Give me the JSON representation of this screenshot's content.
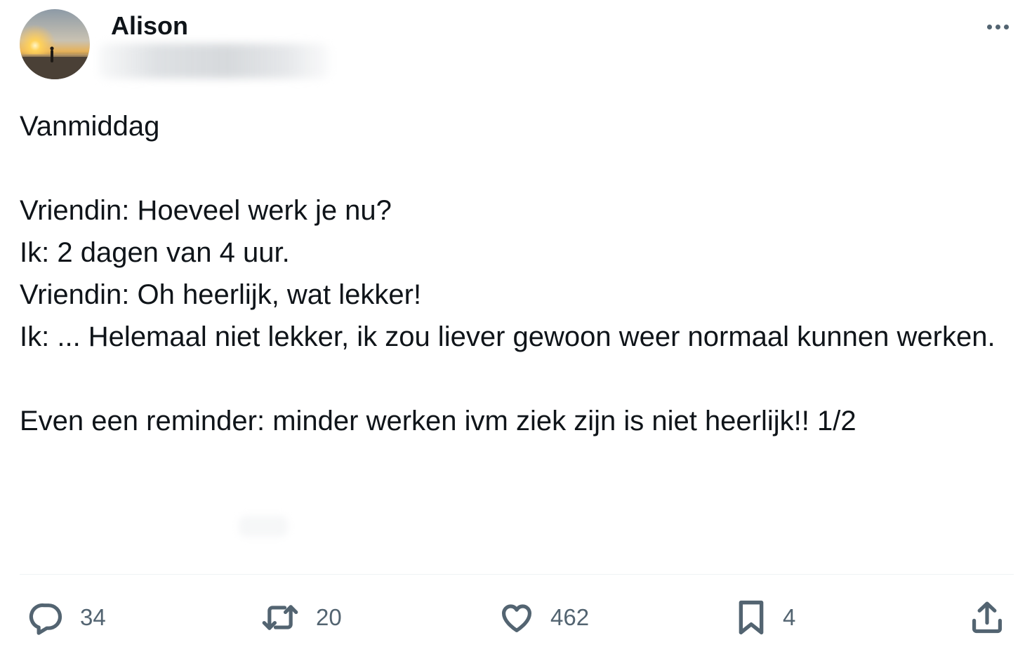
{
  "author": {
    "display_name": "Alison",
    "avatar_icon": "sunset-beach-avatar"
  },
  "tweet": {
    "lines": [
      "Vanmiddag",
      "",
      "Vriendin: Hoeveel werk je nu?",
      "Ik: 2 dagen van 4 uur.",
      "Vriendin: Oh heerlijk, wat lekker!",
      "Ik: ... Helemaal niet lekker, ik zou liever gewoon weer normaal kunnen werken.",
      "",
      "Even een reminder: minder werken ivm ziek zijn is niet heerlijk!! 1/2"
    ]
  },
  "actions": {
    "replies": "34",
    "retweets": "20",
    "likes": "462",
    "bookmarks": "4"
  },
  "icons": {
    "more": "more-horizontal-icon",
    "reply": "reply-bubble-icon",
    "retweet": "retweet-icon",
    "like": "heart-icon",
    "bookmark": "bookmark-icon",
    "share": "share-upload-icon"
  },
  "colors": {
    "text": "#0f1419",
    "secondary": "#536471",
    "divider": "#eff3f4"
  }
}
